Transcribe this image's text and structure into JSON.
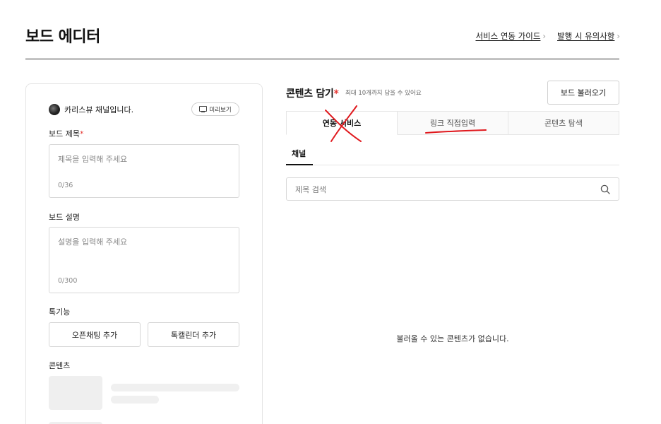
{
  "header": {
    "title": "보드 에디터",
    "links": [
      {
        "label": "서비스 연동 가이드",
        "chevron": "›"
      },
      {
        "label": "발행 시 유의사항",
        "chevron": "›"
      }
    ]
  },
  "left_panel": {
    "channel_name": "카리스뷰 채널입니다.",
    "preview_label": "미리보기",
    "title_field": {
      "label": "보드 제목",
      "required_mark": "*",
      "placeholder": "제목을 입력해 주세요",
      "count": "0/36"
    },
    "desc_field": {
      "label": "보드 설명",
      "placeholder": "설명을 입력해 주세요",
      "count": "0/300"
    },
    "talk_section": {
      "label": "톡기능",
      "buttons": [
        "오픈채팅 추가",
        "톡캘린더 추가"
      ]
    },
    "content_label": "콘텐츠"
  },
  "right_panel": {
    "title": "콘텐츠 담기",
    "required_mark": "*",
    "subtitle": "최대 10개까지 담을 수 있어요",
    "load_button": "보드 불러오기",
    "tabs": [
      {
        "label": "연동 서비스",
        "active": true
      },
      {
        "label": "링크 직접입력",
        "active": false
      },
      {
        "label": "콘텐츠 탐색",
        "active": false
      }
    ],
    "subtab": "채널",
    "search_placeholder": "제목 검색",
    "empty_message": "불러올 수 있는 콘텐츠가 없습니다."
  },
  "colors": {
    "required": "#e53935",
    "annotation": "#e0191e"
  },
  "icons": [
    "monitor-icon",
    "search-icon",
    "chevron-right-icon"
  ]
}
